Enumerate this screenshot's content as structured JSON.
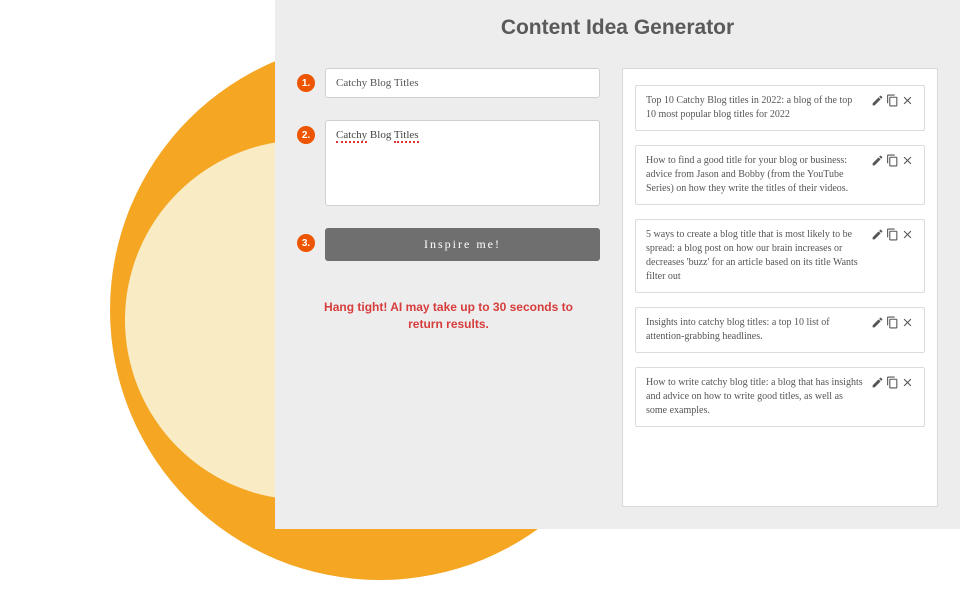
{
  "title": "Content Idea Generator",
  "steps": {
    "step1": {
      "num": "1.",
      "value": "Catchy Blog Titles"
    },
    "step2": {
      "num": "2.",
      "value": "Catchy Blog Titles"
    },
    "step3": {
      "num": "3.",
      "button": "Inspire me!"
    }
  },
  "status": "Hang tight! AI may take up to 30 seconds to return results.",
  "results": [
    {
      "text": "Top 10 Catchy Blog titles in 2022: a blog of the top 10 most popular blog titles for 2022"
    },
    {
      "text": "How to find a good title for your blog or business: advice from Jason and Bobby (from the YouTube Series) on how they write the titles of their videos."
    },
    {
      "text": "5 ways to create a blog title that is most likely to be spread: a blog post on how our brain increases or decreases 'buzz' for an article based on its title Wants filter out"
    },
    {
      "text": "Insights into catchy blog titles: a top 10 list of attention-grabbing headlines."
    },
    {
      "text": "How to write catchy blog title: a blog that has insights and advice on how to write good titles, as well as some examples."
    }
  ],
  "colors": {
    "accent": "#ed5500",
    "circleOuter": "#f5a623",
    "circleInner": "#f9ecc5",
    "panel": "#ededed",
    "status": "#d73c3c"
  }
}
